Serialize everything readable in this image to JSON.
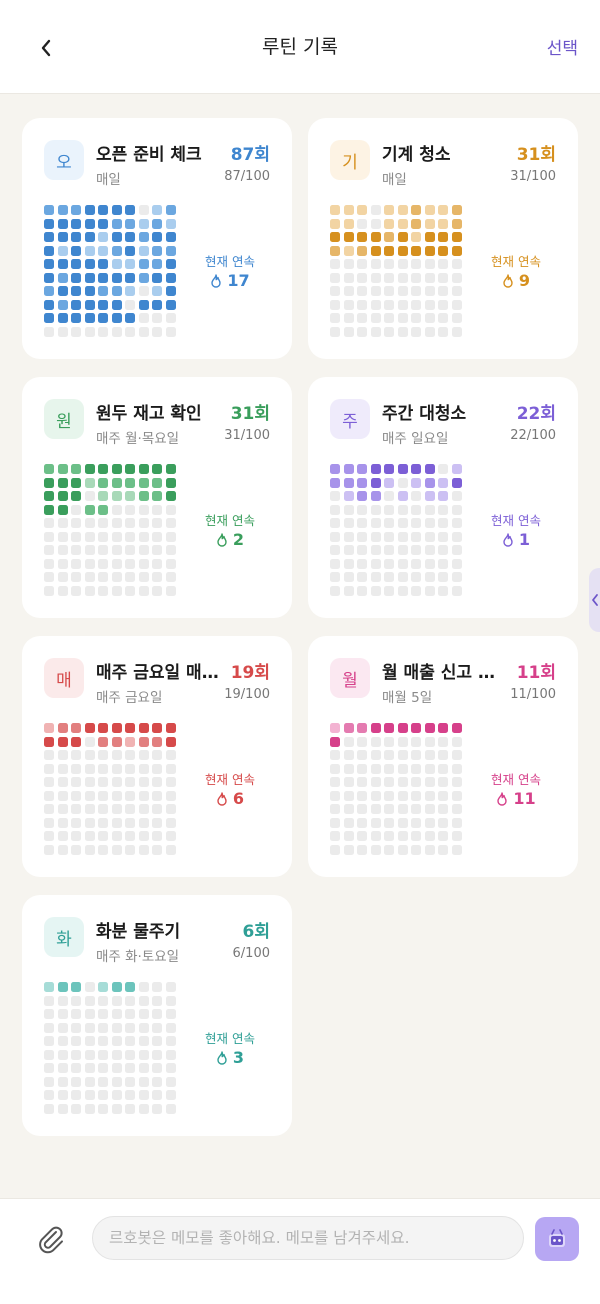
{
  "header": {
    "back_label": "‹",
    "title": "루틴 기록",
    "select_label": "선택"
  },
  "routines": [
    {
      "badge": "오",
      "title": "오픈 준비 체크",
      "count": "87회",
      "schedule": "매일",
      "progress": "87/100",
      "streak_label": "현재 연속",
      "streak": "17",
      "color": "#3f86cf",
      "badge_bg": "#eaf3fc",
      "dot_colors": [
        "#ebebeb",
        "#a9cdee",
        "#6ba7e0",
        "#3f86cf"
      ],
      "dots": [
        2,
        2,
        2,
        3,
        3,
        3,
        3,
        0,
        1,
        2,
        3,
        3,
        3,
        3,
        3,
        2,
        2,
        1,
        2,
        1,
        3,
        3,
        3,
        3,
        1,
        3,
        3,
        2,
        3,
        3,
        3,
        1,
        3,
        1,
        1,
        2,
        3,
        1,
        2,
        2,
        3,
        3,
        3,
        3,
        3,
        1,
        1,
        2,
        2,
        3,
        3,
        2,
        3,
        3,
        3,
        3,
        3,
        2,
        3,
        3,
        2,
        3,
        3,
        3,
        2,
        2,
        1,
        0,
        1,
        3,
        3,
        2,
        3,
        3,
        3,
        3,
        0,
        3,
        3,
        3,
        3,
        3,
        3,
        3,
        3,
        3,
        3,
        0,
        0,
        0,
        0,
        0,
        0,
        0,
        0,
        0,
        0,
        0,
        0,
        0
      ]
    },
    {
      "badge": "기",
      "title": "기계 청소",
      "count": "31회",
      "schedule": "매일",
      "progress": "31/100",
      "streak_label": "현재 연속",
      "streak": "9",
      "color": "#d6901e",
      "badge_bg": "#fdf3e4",
      "dot_colors": [
        "#ebebeb",
        "#f2d4a3",
        "#e6b668",
        "#d6901e"
      ],
      "dots": [
        1,
        1,
        1,
        0,
        1,
        1,
        2,
        1,
        1,
        2,
        1,
        1,
        0,
        0,
        1,
        1,
        2,
        1,
        1,
        2,
        3,
        3,
        3,
        3,
        2,
        3,
        1,
        3,
        3,
        3,
        2,
        1,
        2,
        3,
        3,
        3,
        3,
        3,
        3,
        3,
        0,
        0,
        0,
        0,
        0,
        0,
        0,
        0,
        0,
        0,
        0,
        0,
        0,
        0,
        0,
        0,
        0,
        0,
        0,
        0,
        0,
        0,
        0,
        0,
        0,
        0,
        0,
        0,
        0,
        0,
        0,
        0,
        0,
        0,
        0,
        0,
        0,
        0,
        0,
        0,
        0,
        0,
        0,
        0,
        0,
        0,
        0,
        0,
        0,
        0,
        0,
        0,
        0,
        0,
        0,
        0,
        0,
        0,
        0,
        0
      ]
    },
    {
      "badge": "원",
      "title": "원두 재고 확인",
      "count": "31회",
      "schedule": "매주 월·목요일",
      "progress": "31/100",
      "streak_label": "현재 연속",
      "streak": "2",
      "color": "#3a9e5c",
      "badge_bg": "#e7f5ec",
      "dot_colors": [
        "#ebebeb",
        "#a8d9b8",
        "#6cbf88",
        "#3a9e5c"
      ],
      "dots": [
        2,
        2,
        2,
        3,
        3,
        3,
        3,
        3,
        3,
        3,
        3,
        3,
        3,
        1,
        2,
        2,
        2,
        2,
        2,
        3,
        3,
        3,
        3,
        0,
        1,
        1,
        1,
        2,
        2,
        3,
        3,
        3,
        0,
        2,
        2,
        0,
        0,
        0,
        0,
        0,
        0,
        0,
        0,
        0,
        0,
        0,
        0,
        0,
        0,
        0,
        0,
        0,
        0,
        0,
        0,
        0,
        0,
        0,
        0,
        0,
        0,
        0,
        0,
        0,
        0,
        0,
        0,
        0,
        0,
        0,
        0,
        0,
        0,
        0,
        0,
        0,
        0,
        0,
        0,
        0,
        0,
        0,
        0,
        0,
        0,
        0,
        0,
        0,
        0,
        0,
        0,
        0,
        0,
        0,
        0,
        0,
        0,
        0,
        0,
        0
      ]
    },
    {
      "badge": "주",
      "title": "주간 대청소",
      "count": "22회",
      "schedule": "매주 일요일",
      "progress": "22/100",
      "streak_label": "현재 연속",
      "streak": "1",
      "color": "#7c5fd6",
      "badge_bg": "#efebfb",
      "dot_colors": [
        "#ebebeb",
        "#ccc0f3",
        "#a793ea",
        "#7c5fd6"
      ],
      "dots": [
        2,
        2,
        2,
        3,
        3,
        3,
        3,
        3,
        0,
        1,
        2,
        2,
        2,
        3,
        1,
        0,
        1,
        2,
        1,
        3,
        0,
        1,
        2,
        2,
        0,
        1,
        0,
        1,
        1,
        0,
        0,
        0,
        0,
        0,
        0,
        0,
        0,
        0,
        0,
        0,
        0,
        0,
        0,
        0,
        0,
        0,
        0,
        0,
        0,
        0,
        0,
        0,
        0,
        0,
        0,
        0,
        0,
        0,
        0,
        0,
        0,
        0,
        0,
        0,
        0,
        0,
        0,
        0,
        0,
        0,
        0,
        0,
        0,
        0,
        0,
        0,
        0,
        0,
        0,
        0,
        0,
        0,
        0,
        0,
        0,
        0,
        0,
        0,
        0,
        0,
        0,
        0,
        0,
        0,
        0,
        0,
        0,
        0,
        0,
        0
      ]
    },
    {
      "badge": "매",
      "title": "매주 금요일 매출 정산",
      "count": "19회",
      "schedule": "매주 금요일",
      "progress": "19/100",
      "streak_label": "현재 연속",
      "streak": "6",
      "color": "#d64a4a",
      "badge_bg": "#fbeaea",
      "dot_colors": [
        "#ebebeb",
        "#f0b3b3",
        "#e27f7f",
        "#d64a4a"
      ],
      "dots": [
        1,
        2,
        2,
        3,
        3,
        3,
        3,
        3,
        3,
        3,
        3,
        3,
        3,
        0,
        2,
        2,
        1,
        2,
        2,
        3,
        0,
        0,
        0,
        0,
        0,
        0,
        0,
        0,
        0,
        0,
        0,
        0,
        0,
        0,
        0,
        0,
        0,
        0,
        0,
        0,
        0,
        0,
        0,
        0,
        0,
        0,
        0,
        0,
        0,
        0,
        0,
        0,
        0,
        0,
        0,
        0,
        0,
        0,
        0,
        0,
        0,
        0,
        0,
        0,
        0,
        0,
        0,
        0,
        0,
        0,
        0,
        0,
        0,
        0,
        0,
        0,
        0,
        0,
        0,
        0,
        0,
        0,
        0,
        0,
        0,
        0,
        0,
        0,
        0,
        0,
        0,
        0,
        0,
        0,
        0,
        0,
        0,
        0,
        0,
        0
      ]
    },
    {
      "badge": "월",
      "title": "월 매출 신고 자료 정리",
      "count": "11회",
      "schedule": "매월 5일",
      "progress": "11/100",
      "streak_label": "현재 연속",
      "streak": "11",
      "color": "#d6408a",
      "badge_bg": "#fbe8f1",
      "dot_colors": [
        "#ebebeb",
        "#f3b3d2",
        "#e47bb0",
        "#d6408a"
      ],
      "dots": [
        1,
        2,
        2,
        3,
        3,
        3,
        3,
        3,
        3,
        3,
        3,
        0,
        0,
        0,
        0,
        0,
        0,
        0,
        0,
        0,
        0,
        0,
        0,
        0,
        0,
        0,
        0,
        0,
        0,
        0,
        0,
        0,
        0,
        0,
        0,
        0,
        0,
        0,
        0,
        0,
        0,
        0,
        0,
        0,
        0,
        0,
        0,
        0,
        0,
        0,
        0,
        0,
        0,
        0,
        0,
        0,
        0,
        0,
        0,
        0,
        0,
        0,
        0,
        0,
        0,
        0,
        0,
        0,
        0,
        0,
        0,
        0,
        0,
        0,
        0,
        0,
        0,
        0,
        0,
        0,
        0,
        0,
        0,
        0,
        0,
        0,
        0,
        0,
        0,
        0,
        0,
        0,
        0,
        0,
        0,
        0,
        0,
        0,
        0,
        0
      ]
    },
    {
      "badge": "화",
      "title": "화분 물주기",
      "count": "6회",
      "schedule": "매주 화·토요일",
      "progress": "6/100",
      "streak_label": "현재 연속",
      "streak": "3",
      "color": "#2f9f96",
      "badge_bg": "#e5f5f3",
      "dot_colors": [
        "#ebebeb",
        "#a6dcd7",
        "#6cc4bc",
        "#2f9f96"
      ],
      "dots": [
        1,
        2,
        2,
        0,
        1,
        2,
        2,
        0,
        0,
        0,
        0,
        0,
        0,
        0,
        0,
        0,
        0,
        0,
        0,
        0,
        0,
        0,
        0,
        0,
        0,
        0,
        0,
        0,
        0,
        0,
        0,
        0,
        0,
        0,
        0,
        0,
        0,
        0,
        0,
        0,
        0,
        0,
        0,
        0,
        0,
        0,
        0,
        0,
        0,
        0,
        0,
        0,
        0,
        0,
        0,
        0,
        0,
        0,
        0,
        0,
        0,
        0,
        0,
        0,
        0,
        0,
        0,
        0,
        0,
        0,
        0,
        0,
        0,
        0,
        0,
        0,
        0,
        0,
        0,
        0,
        0,
        0,
        0,
        0,
        0,
        0,
        0,
        0,
        0,
        0,
        0,
        0,
        0,
        0,
        0,
        0,
        0,
        0,
        0,
        0
      ]
    }
  ],
  "side_tab": {
    "label": "‹"
  },
  "composer": {
    "placeholder": "르호봇은 메모를 좋아해요. 메모를 남겨주세요.",
    "value": ""
  },
  "colors": {
    "accent": "#6b55c9",
    "bot_button": "#b7a7f3"
  }
}
